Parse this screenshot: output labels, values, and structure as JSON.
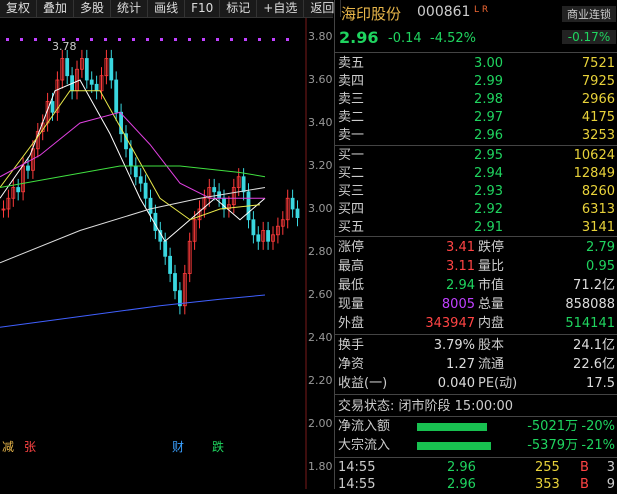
{
  "toolbar": [
    "复权",
    "叠加",
    "多股",
    "统计",
    "画线",
    "F10",
    "标记",
    "+自选",
    "返回"
  ],
  "chart": {
    "y_ticks": [
      "3.80",
      "3.60",
      "3.40",
      "3.20",
      "3.00",
      "2.80",
      "2.60",
      "2.40",
      "2.20",
      "2.00",
      "1.80"
    ],
    "high_label": "3.78",
    "markers": [
      {
        "text": "减",
        "color": "#e8b64a"
      },
      {
        "text": "张",
        "color": "#ff4444"
      },
      {
        "text": "财",
        "color": "#3aa0ff"
      },
      {
        "text": "跌",
        "color": "#1fd45f"
      }
    ]
  },
  "quote": {
    "name": "海印股份",
    "code": "000861",
    "lr": "L R",
    "sector": "商业连锁",
    "price": "2.96",
    "change": "-0.14",
    "change_pct": "-4.52%",
    "sector_pct": "-0.17%"
  },
  "sells": [
    {
      "label": "卖五",
      "price": "3.00",
      "vol": "7521"
    },
    {
      "label": "卖四",
      "price": "2.99",
      "vol": "7925"
    },
    {
      "label": "卖三",
      "price": "2.98",
      "vol": "2966"
    },
    {
      "label": "卖二",
      "price": "2.97",
      "vol": "4175"
    },
    {
      "label": "卖一",
      "price": "2.96",
      "vol": "3253"
    }
  ],
  "buys": [
    {
      "label": "买一",
      "price": "2.95",
      "vol": "10624"
    },
    {
      "label": "买二",
      "price": "2.94",
      "vol": "12849"
    },
    {
      "label": "买三",
      "price": "2.93",
      "vol": "8260"
    },
    {
      "label": "买四",
      "price": "2.92",
      "vol": "6313"
    },
    {
      "label": "买五",
      "price": "2.91",
      "vol": "3141"
    }
  ],
  "stats1": [
    {
      "l1": "涨停",
      "v1": "3.41",
      "c1": "red",
      "l2": "跌停",
      "v2": "2.79",
      "c2": "green"
    },
    {
      "l1": "最高",
      "v1": "3.11",
      "c1": "red",
      "l2": "量比",
      "v2": "0.95",
      "c2": "green"
    },
    {
      "l1": "最低",
      "v1": "2.94",
      "c1": "green",
      "l2": "市值",
      "v2": "71.2亿",
      "c2": "white"
    },
    {
      "l1": "现量",
      "v1": "8005",
      "c1": "purple",
      "l2": "总量",
      "v2": "858088",
      "c2": "white"
    },
    {
      "l1": "外盘",
      "v1": "343947",
      "c1": "red",
      "l2": "内盘",
      "v2": "514141",
      "c2": "green"
    }
  ],
  "stats2": [
    {
      "l1": "换手",
      "v1": "3.79%",
      "c1": "white",
      "l2": "股本",
      "v2": "24.1亿",
      "c2": "white"
    },
    {
      "l1": "净资",
      "v1": "1.27",
      "c1": "white",
      "l2": "流通",
      "v2": "22.6亿",
      "c2": "white"
    },
    {
      "l1": "收益(一)",
      "v1": "0.040",
      "c1": "white",
      "l2": "PE(动)",
      "v2": "17.5",
      "c2": "white"
    }
  ],
  "trade_status": "交易状态: 闭市阶段 15:00:00",
  "flows": [
    {
      "label": "净流入额",
      "value": "-5021万",
      "pct": "-20%",
      "fill": 0.2
    },
    {
      "label": "大宗流入",
      "value": "-5379万",
      "pct": "-21%",
      "fill": 0.21
    }
  ],
  "ticks": [
    {
      "time": "14:55",
      "price": "2.96",
      "vol": "255",
      "side": "B",
      "count": "3"
    },
    {
      "time": "14:55",
      "price": "2.96",
      "vol": "353",
      "side": "B",
      "count": "9"
    }
  ]
}
